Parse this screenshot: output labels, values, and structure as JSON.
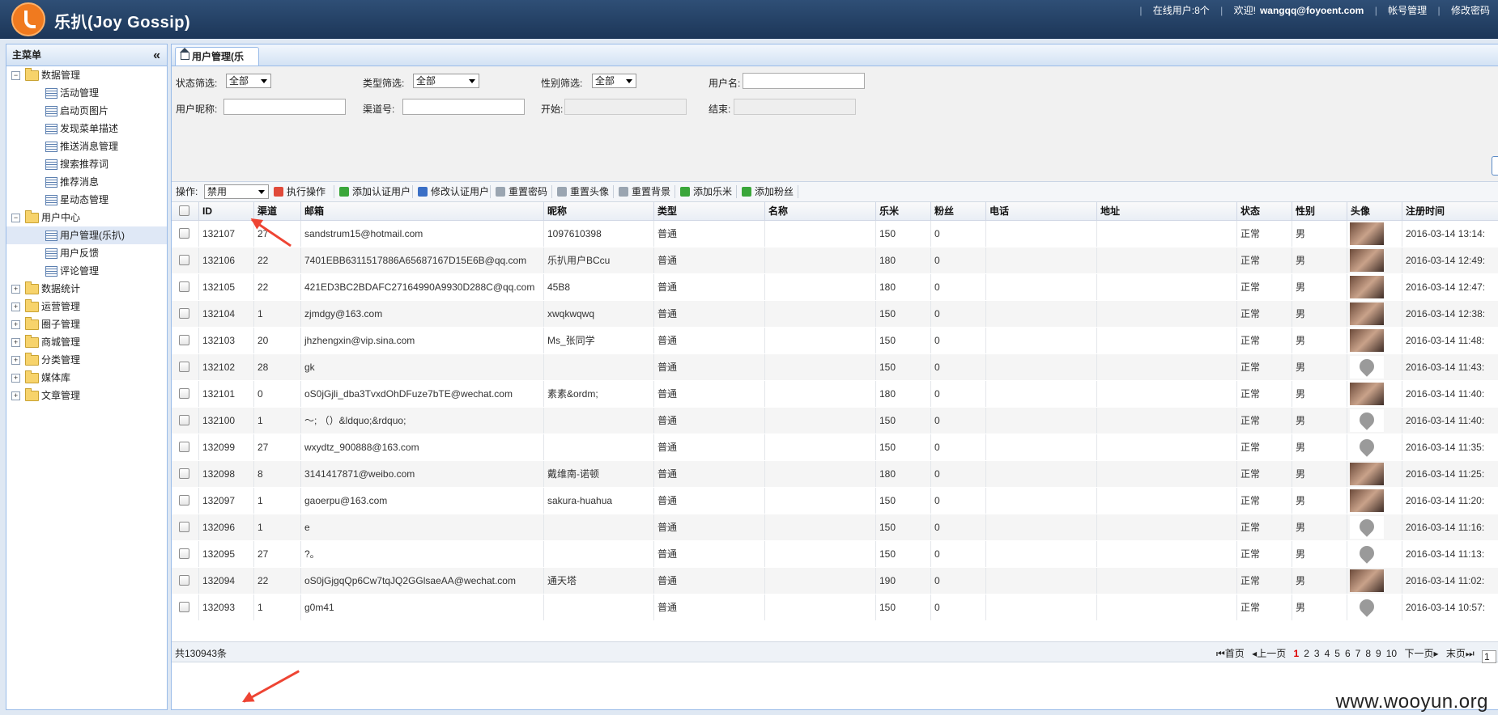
{
  "header": {
    "app_title": "乐扒(Joy Gossip)",
    "online_users": "在线用户:8个",
    "welcome": "欢迎!",
    "email": "wangqq@foyoent.com",
    "account_mgmt": "帐号管理",
    "change_password": "修改密码"
  },
  "sidebar": {
    "title": "主菜单",
    "collapse_glyph": "«",
    "nodes": [
      {
        "label": "数据管理",
        "type": "folder",
        "expanded": true
      },
      {
        "label": "活动管理",
        "type": "leaf"
      },
      {
        "label": "启动页图片",
        "type": "leaf"
      },
      {
        "label": "发现菜单描述",
        "type": "leaf"
      },
      {
        "label": "推送消息管理",
        "type": "leaf"
      },
      {
        "label": "搜索推荐词",
        "type": "leaf"
      },
      {
        "label": "推荐消息",
        "type": "leaf"
      },
      {
        "label": "星动态管理",
        "type": "leaf"
      },
      {
        "label": "用户中心",
        "type": "folder",
        "expanded": true
      },
      {
        "label": "用户管理(乐扒)",
        "type": "leaf",
        "selected": true
      },
      {
        "label": "用户反馈",
        "type": "leaf"
      },
      {
        "label": "评论管理",
        "type": "leaf"
      },
      {
        "label": "数据统计",
        "type": "folder",
        "expanded": false
      },
      {
        "label": "运营管理",
        "type": "folder",
        "expanded": false
      },
      {
        "label": "圈子管理",
        "type": "folder",
        "expanded": false
      },
      {
        "label": "商城管理",
        "type": "folder",
        "expanded": false
      },
      {
        "label": "分类管理",
        "type": "folder",
        "expanded": false
      },
      {
        "label": "媒体库",
        "type": "folder",
        "expanded": false
      },
      {
        "label": "文章管理",
        "type": "folder",
        "expanded": false
      }
    ]
  },
  "tab": {
    "label": "用户管理(乐"
  },
  "filters": {
    "status_label": "状态筛选:",
    "status_value": "全部",
    "type_label": "类型筛选:",
    "type_value": "全部",
    "gender_label": "性别筛选:",
    "gender_value": "全部",
    "username_label": "用户名:",
    "username_value": "",
    "nickname_label": "用户昵称:",
    "nickname_value": "",
    "channel_label": "渠道号:",
    "channel_value": "",
    "start_label": "开始:",
    "start_value": "",
    "end_label": "结束:",
    "end_value": ""
  },
  "toolbar": {
    "op_label": "操作:",
    "op_value": "禁用",
    "execute": "执行操作",
    "add_verified": "添加认证用户",
    "edit_verified": "修改认证用户",
    "reset_password": "重置密码",
    "reset_avatar": "重置头像",
    "reset_background": "重置背景",
    "add_lemi": "添加乐米",
    "add_fans": "添加粉丝"
  },
  "table": {
    "columns": [
      "ID",
      "渠道",
      "邮箱",
      "昵称",
      "类型",
      "名称",
      "乐米",
      "粉丝",
      "电话",
      "地址",
      "状态",
      "性别",
      "头像",
      "注册时间"
    ],
    "rows": [
      {
        "id": "132107",
        "channel": "27",
        "email": "sandstrum15@hotmail.com",
        "nickname": "1097610398",
        "type": "普通",
        "name": "",
        "lemi": "150",
        "fans": "0",
        "phone": "",
        "address": "",
        "status": "正常",
        "gender": "男",
        "avatar": "photo",
        "reg_time": "2016-03-14 13:14:"
      },
      {
        "id": "132106",
        "channel": "22",
        "email": "7401EBB6311517886A65687167D15E6B@qq.com",
        "nickname": "乐扒用户BCcu",
        "type": "普通",
        "name": "",
        "lemi": "180",
        "fans": "0",
        "phone": "",
        "address": "",
        "status": "正常",
        "gender": "男",
        "avatar": "photo",
        "reg_time": "2016-03-14 12:49:"
      },
      {
        "id": "132105",
        "channel": "22",
        "email": "421ED3BC2BDAFC27164990A9930D288C@qq.com",
        "nickname": "45B8",
        "type": "普通",
        "name": "",
        "lemi": "180",
        "fans": "0",
        "phone": "",
        "address": "",
        "status": "正常",
        "gender": "男",
        "avatar": "photo",
        "reg_time": "2016-03-14 12:47:"
      },
      {
        "id": "132104",
        "channel": "1",
        "email": "zjmdgy@163.com",
        "nickname": "xwqkwqwq",
        "type": "普通",
        "name": "",
        "lemi": "150",
        "fans": "0",
        "phone": "",
        "address": "",
        "status": "正常",
        "gender": "男",
        "avatar": "photo",
        "reg_time": "2016-03-14 12:38:"
      },
      {
        "id": "132103",
        "channel": "20",
        "email": "jhzhengxin@vip.sina.com",
        "nickname": "Ms_张同学",
        "type": "普通",
        "name": "",
        "lemi": "150",
        "fans": "0",
        "phone": "",
        "address": "",
        "status": "正常",
        "gender": "男",
        "avatar": "photo",
        "reg_time": "2016-03-14 11:48:"
      },
      {
        "id": "132102",
        "channel": "28",
        "email": "gk",
        "nickname": "",
        "type": "普通",
        "name": "",
        "lemi": "150",
        "fans": "0",
        "phone": "",
        "address": "",
        "status": "正常",
        "gender": "男",
        "avatar": "default",
        "reg_time": "2016-03-14 11:43:"
      },
      {
        "id": "132101",
        "channel": "0",
        "email": "oS0jGjli_dba3TvxdOhDFuze7bTE@wechat.com",
        "nickname": "素素&ordm;",
        "type": "普通",
        "name": "",
        "lemi": "180",
        "fans": "0",
        "phone": "",
        "address": "",
        "status": "正常",
        "gender": "男",
        "avatar": "photo",
        "reg_time": "2016-03-14 11:40:"
      },
      {
        "id": "132100",
        "channel": "1",
        "email": "～; （）&ldquo;&rdquo;",
        "nickname": "",
        "type": "普通",
        "name": "",
        "lemi": "150",
        "fans": "0",
        "phone": "",
        "address": "",
        "status": "正常",
        "gender": "男",
        "avatar": "default",
        "reg_time": "2016-03-14 11:40:"
      },
      {
        "id": "132099",
        "channel": "27",
        "email": "wxydtz_900888@163.com",
        "nickname": "",
        "type": "普通",
        "name": "",
        "lemi": "150",
        "fans": "0",
        "phone": "",
        "address": "",
        "status": "正常",
        "gender": "男",
        "avatar": "default",
        "reg_time": "2016-03-14 11:35:"
      },
      {
        "id": "132098",
        "channel": "8",
        "email": "3141417871@weibo.com",
        "nickname": "戴维南-诺顿",
        "type": "普通",
        "name": "",
        "lemi": "180",
        "fans": "0",
        "phone": "",
        "address": "",
        "status": "正常",
        "gender": "男",
        "avatar": "photo",
        "reg_time": "2016-03-14 11:25:"
      },
      {
        "id": "132097",
        "channel": "1",
        "email": "gaoerpu@163.com",
        "nickname": "sakura-huahua",
        "type": "普通",
        "name": "",
        "lemi": "150",
        "fans": "0",
        "phone": "",
        "address": "",
        "status": "正常",
        "gender": "男",
        "avatar": "photo",
        "reg_time": "2016-03-14 11:20:"
      },
      {
        "id": "132096",
        "channel": "1",
        "email": "e",
        "nickname": "",
        "type": "普通",
        "name": "",
        "lemi": "150",
        "fans": "0",
        "phone": "",
        "address": "",
        "status": "正常",
        "gender": "男",
        "avatar": "default",
        "reg_time": "2016-03-14 11:16:"
      },
      {
        "id": "132095",
        "channel": "27",
        "email": "?。",
        "nickname": "",
        "type": "普通",
        "name": "",
        "lemi": "150",
        "fans": "0",
        "phone": "",
        "address": "",
        "status": "正常",
        "gender": "男",
        "avatar": "default",
        "reg_time": "2016-03-14 11:13:"
      },
      {
        "id": "132094",
        "channel": "22",
        "email": "oS0jGjgqQp6Cw7tqJQ2GGlsaeAA@wechat.com",
        "nickname": "通天塔",
        "type": "普通",
        "name": "",
        "lemi": "190",
        "fans": "0",
        "phone": "",
        "address": "",
        "status": "正常",
        "gender": "男",
        "avatar": "photo",
        "reg_time": "2016-03-14 11:02:"
      },
      {
        "id": "132093",
        "channel": "1",
        "email": "g0m41",
        "nickname": "",
        "type": "普通",
        "name": "",
        "lemi": "150",
        "fans": "0",
        "phone": "",
        "address": "",
        "status": "正常",
        "gender": "男",
        "avatar": "default",
        "reg_time": "2016-03-14 10:57:"
      }
    ]
  },
  "footer": {
    "total": "共130943条",
    "first": "首页",
    "prev": "上一页",
    "pages": [
      "1",
      "2",
      "3",
      "4",
      "5",
      "6",
      "7",
      "8",
      "9",
      "10"
    ],
    "current_page": "1",
    "next": "下一页",
    "last": "末页",
    "page_input": "1"
  },
  "watermark": "www.wooyun.org",
  "colors": {
    "header_bg": "#1c3658",
    "accent": "#99bbe8",
    "annotation": "#e43"
  }
}
